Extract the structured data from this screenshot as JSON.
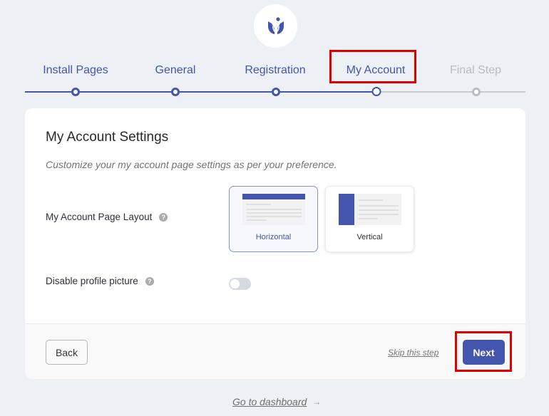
{
  "brand": {
    "logo_icon": "tulip-logo-icon",
    "accent_color": "#4355ad"
  },
  "steps": [
    {
      "label": "Install Pages",
      "state": "completed"
    },
    {
      "label": "General",
      "state": "completed"
    },
    {
      "label": "Registration",
      "state": "completed"
    },
    {
      "label": "My Account",
      "state": "current"
    },
    {
      "label": "Final Step",
      "state": "upcoming"
    }
  ],
  "card": {
    "title": "My Account Settings",
    "description": "Customize your my account page settings as per your preference.",
    "layout_setting": {
      "label": "My Account Page Layout",
      "help_icon": "question-circle-icon",
      "options": [
        {
          "label": "Horizontal",
          "selected": true
        },
        {
          "label": "Vertical",
          "selected": false
        }
      ]
    },
    "profile_setting": {
      "label": "Disable profile picture",
      "help_icon": "question-circle-icon",
      "enabled": false
    }
  },
  "footer": {
    "back_label": "Back",
    "skip_label": "Skip this step",
    "next_label": "Next"
  },
  "dashboard_link": {
    "label": "Go to dashboard",
    "arrow": "→"
  },
  "annotations": {
    "highlight_color": "#e00000"
  }
}
